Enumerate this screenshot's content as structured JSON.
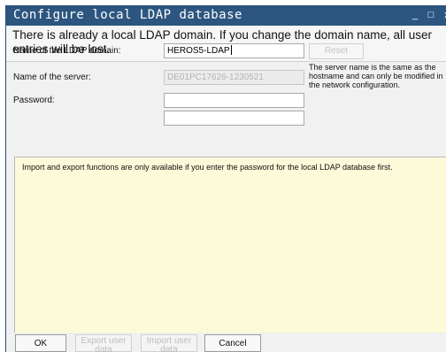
{
  "window": {
    "title": "Configure local LDAP database",
    "controls": {
      "minimize": "_",
      "maximize": "□",
      "close": "x"
    }
  },
  "header": {
    "message": "There is already a local LDAP domain. If you change the domain name, all user entries will be lost."
  },
  "form": {
    "domain_label": "Name of the LDAP domain:",
    "domain_value": "HEROS5-LDAP",
    "server_label": "Name of the server:",
    "server_value": "DE01PC17626-1230521",
    "password_label": "Password:",
    "password_value": "",
    "password_confirm_value": "",
    "reset_label": "Reset",
    "server_note": "The server name is the same as the hostname and can only be modified in the network configuration."
  },
  "info": {
    "text": "Import and export functions are only available if you enter the password for the local LDAP database first."
  },
  "buttons": {
    "ok": "OK",
    "export": "Export user data",
    "import": "Import user data",
    "cancel": "Cancel"
  }
}
